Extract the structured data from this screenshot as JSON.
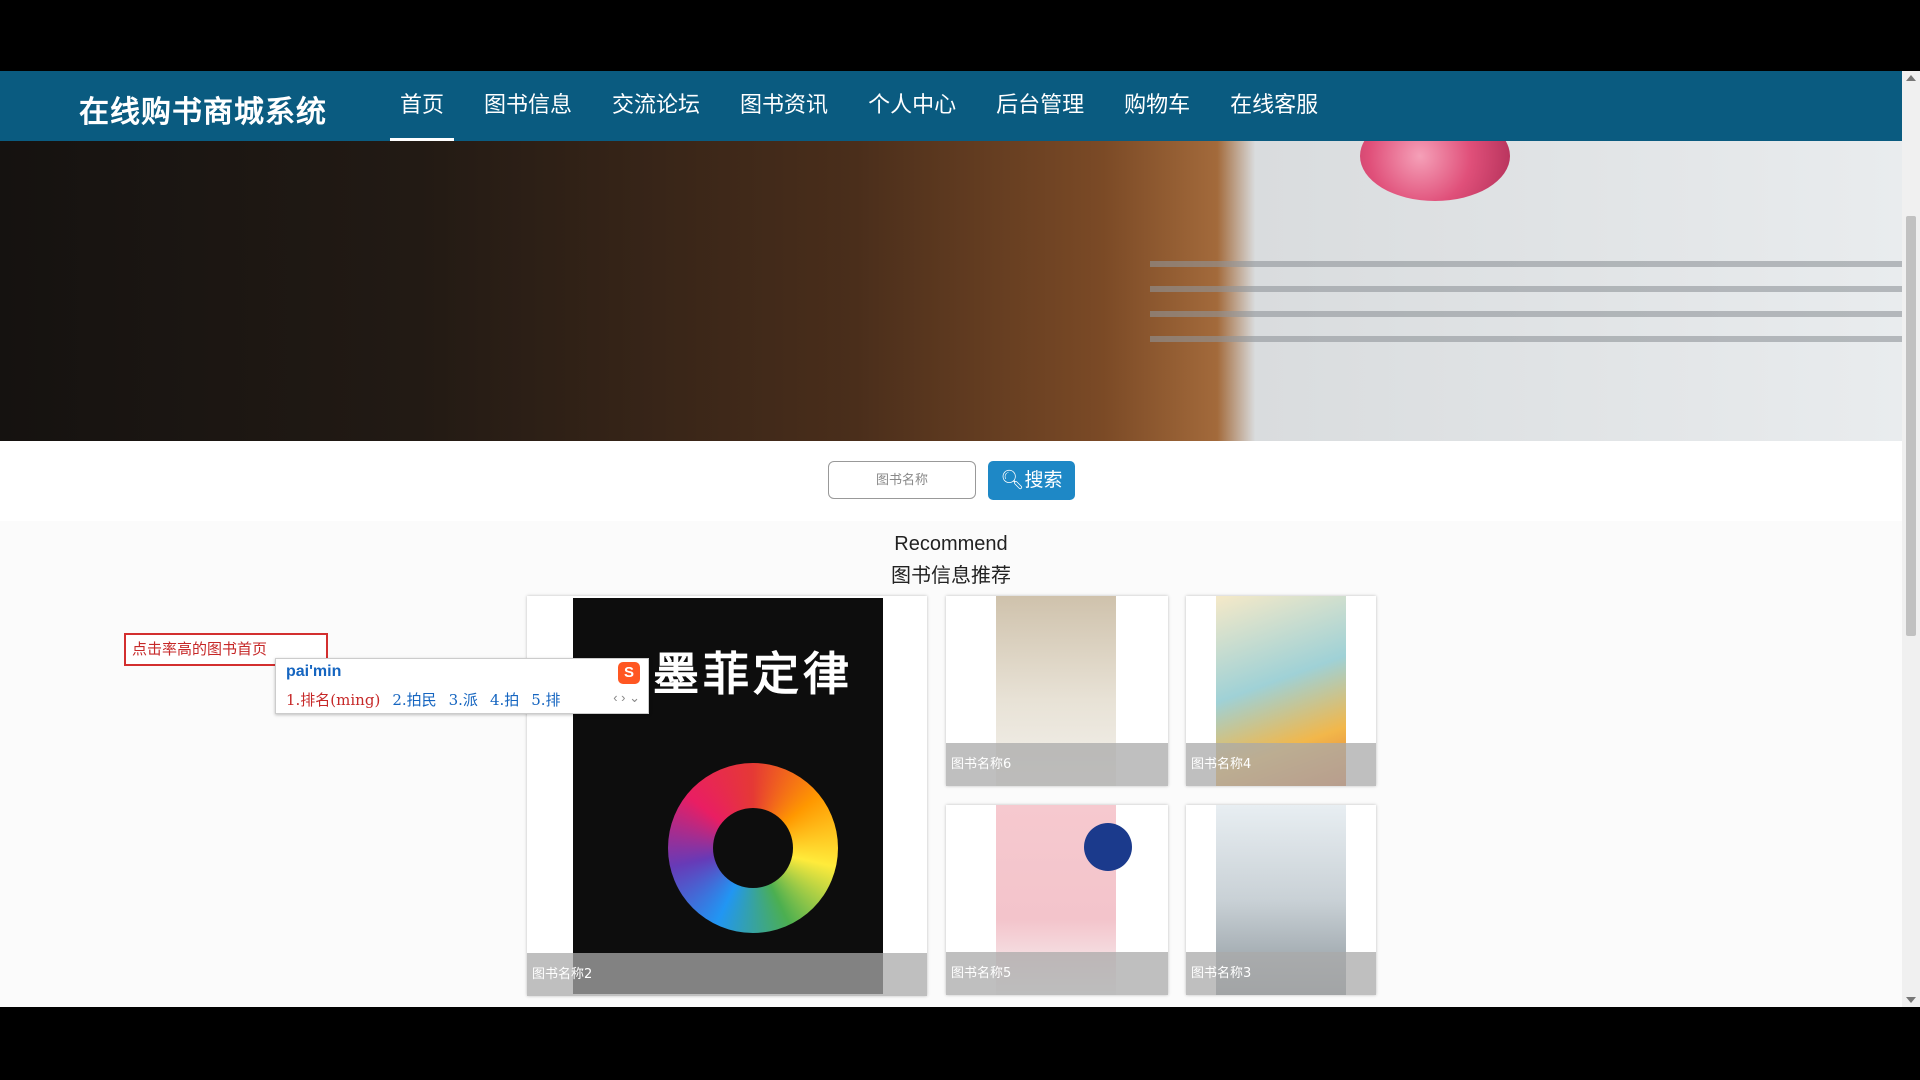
{
  "navbar": {
    "brand": "在线购书商城系统",
    "items": [
      {
        "label": "首页",
        "active": true
      },
      {
        "label": "图书信息"
      },
      {
        "label": "交流论坛"
      },
      {
        "label": "图书资讯"
      },
      {
        "label": "个人中心"
      },
      {
        "label": "后台管理"
      },
      {
        "label": "购物车"
      },
      {
        "label": "在线客服"
      }
    ],
    "accent_color": "#0a5b80"
  },
  "banner": {
    "slides": 3,
    "active_slide": 1
  },
  "search": {
    "placeholder": "图书名称",
    "button_label": "搜索",
    "button_color": "#1e88c6"
  },
  "recommend": {
    "title_en": "Recommend",
    "title_cn": "图书信息推荐",
    "books": [
      {
        "name": "图书名称2",
        "cover_title": "墨菲定律"
      },
      {
        "name": "图书名称6"
      },
      {
        "name": "图书名称4"
      },
      {
        "name": "图书名称5"
      },
      {
        "name": "图书名称3"
      }
    ]
  },
  "ime": {
    "input_text": "点击率高的图书首页",
    "composition": "pai'min",
    "candidates": [
      "1.排名(ming)",
      "2.拍民",
      "3.派",
      "4.拍",
      "5.排"
    ]
  }
}
